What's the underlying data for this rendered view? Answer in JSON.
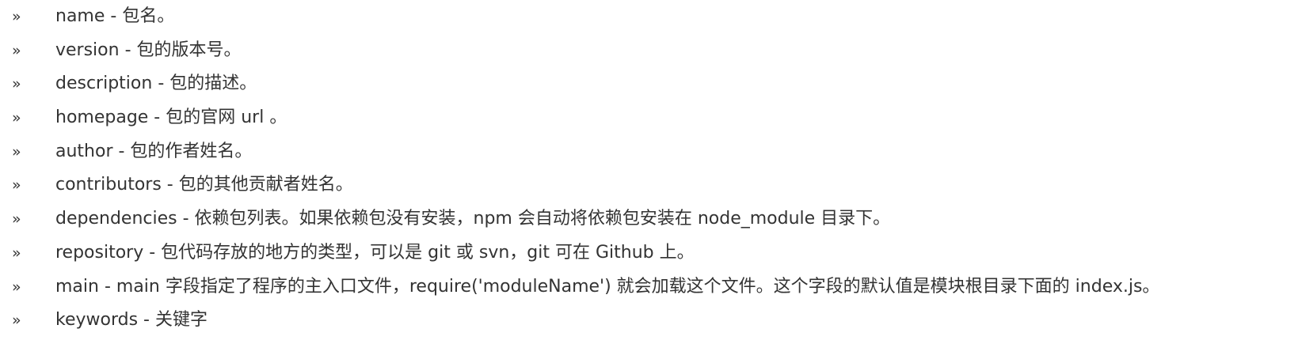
{
  "bullet_glyph": "»",
  "items": [
    {
      "text": "name - 包名。"
    },
    {
      "text": "version - 包的版本号。"
    },
    {
      "text": "description - 包的描述。"
    },
    {
      "text": "homepage - 包的官网 url 。"
    },
    {
      "text": "author - 包的作者姓名。"
    },
    {
      "text": "contributors - 包的其他贡献者姓名。"
    },
    {
      "text": "dependencies - 依赖包列表。如果依赖包没有安装，npm 会自动将依赖包安装在 node_module 目录下。"
    },
    {
      "text": "repository - 包代码存放的地方的类型，可以是 git 或 svn，git 可在 Github 上。"
    },
    {
      "text": "main - main 字段指定了程序的主入口文件，require('moduleName') 就会加载这个文件。这个字段的默认值是模块根目录下面的 index.js。"
    },
    {
      "text": "keywords - 关键字"
    }
  ]
}
